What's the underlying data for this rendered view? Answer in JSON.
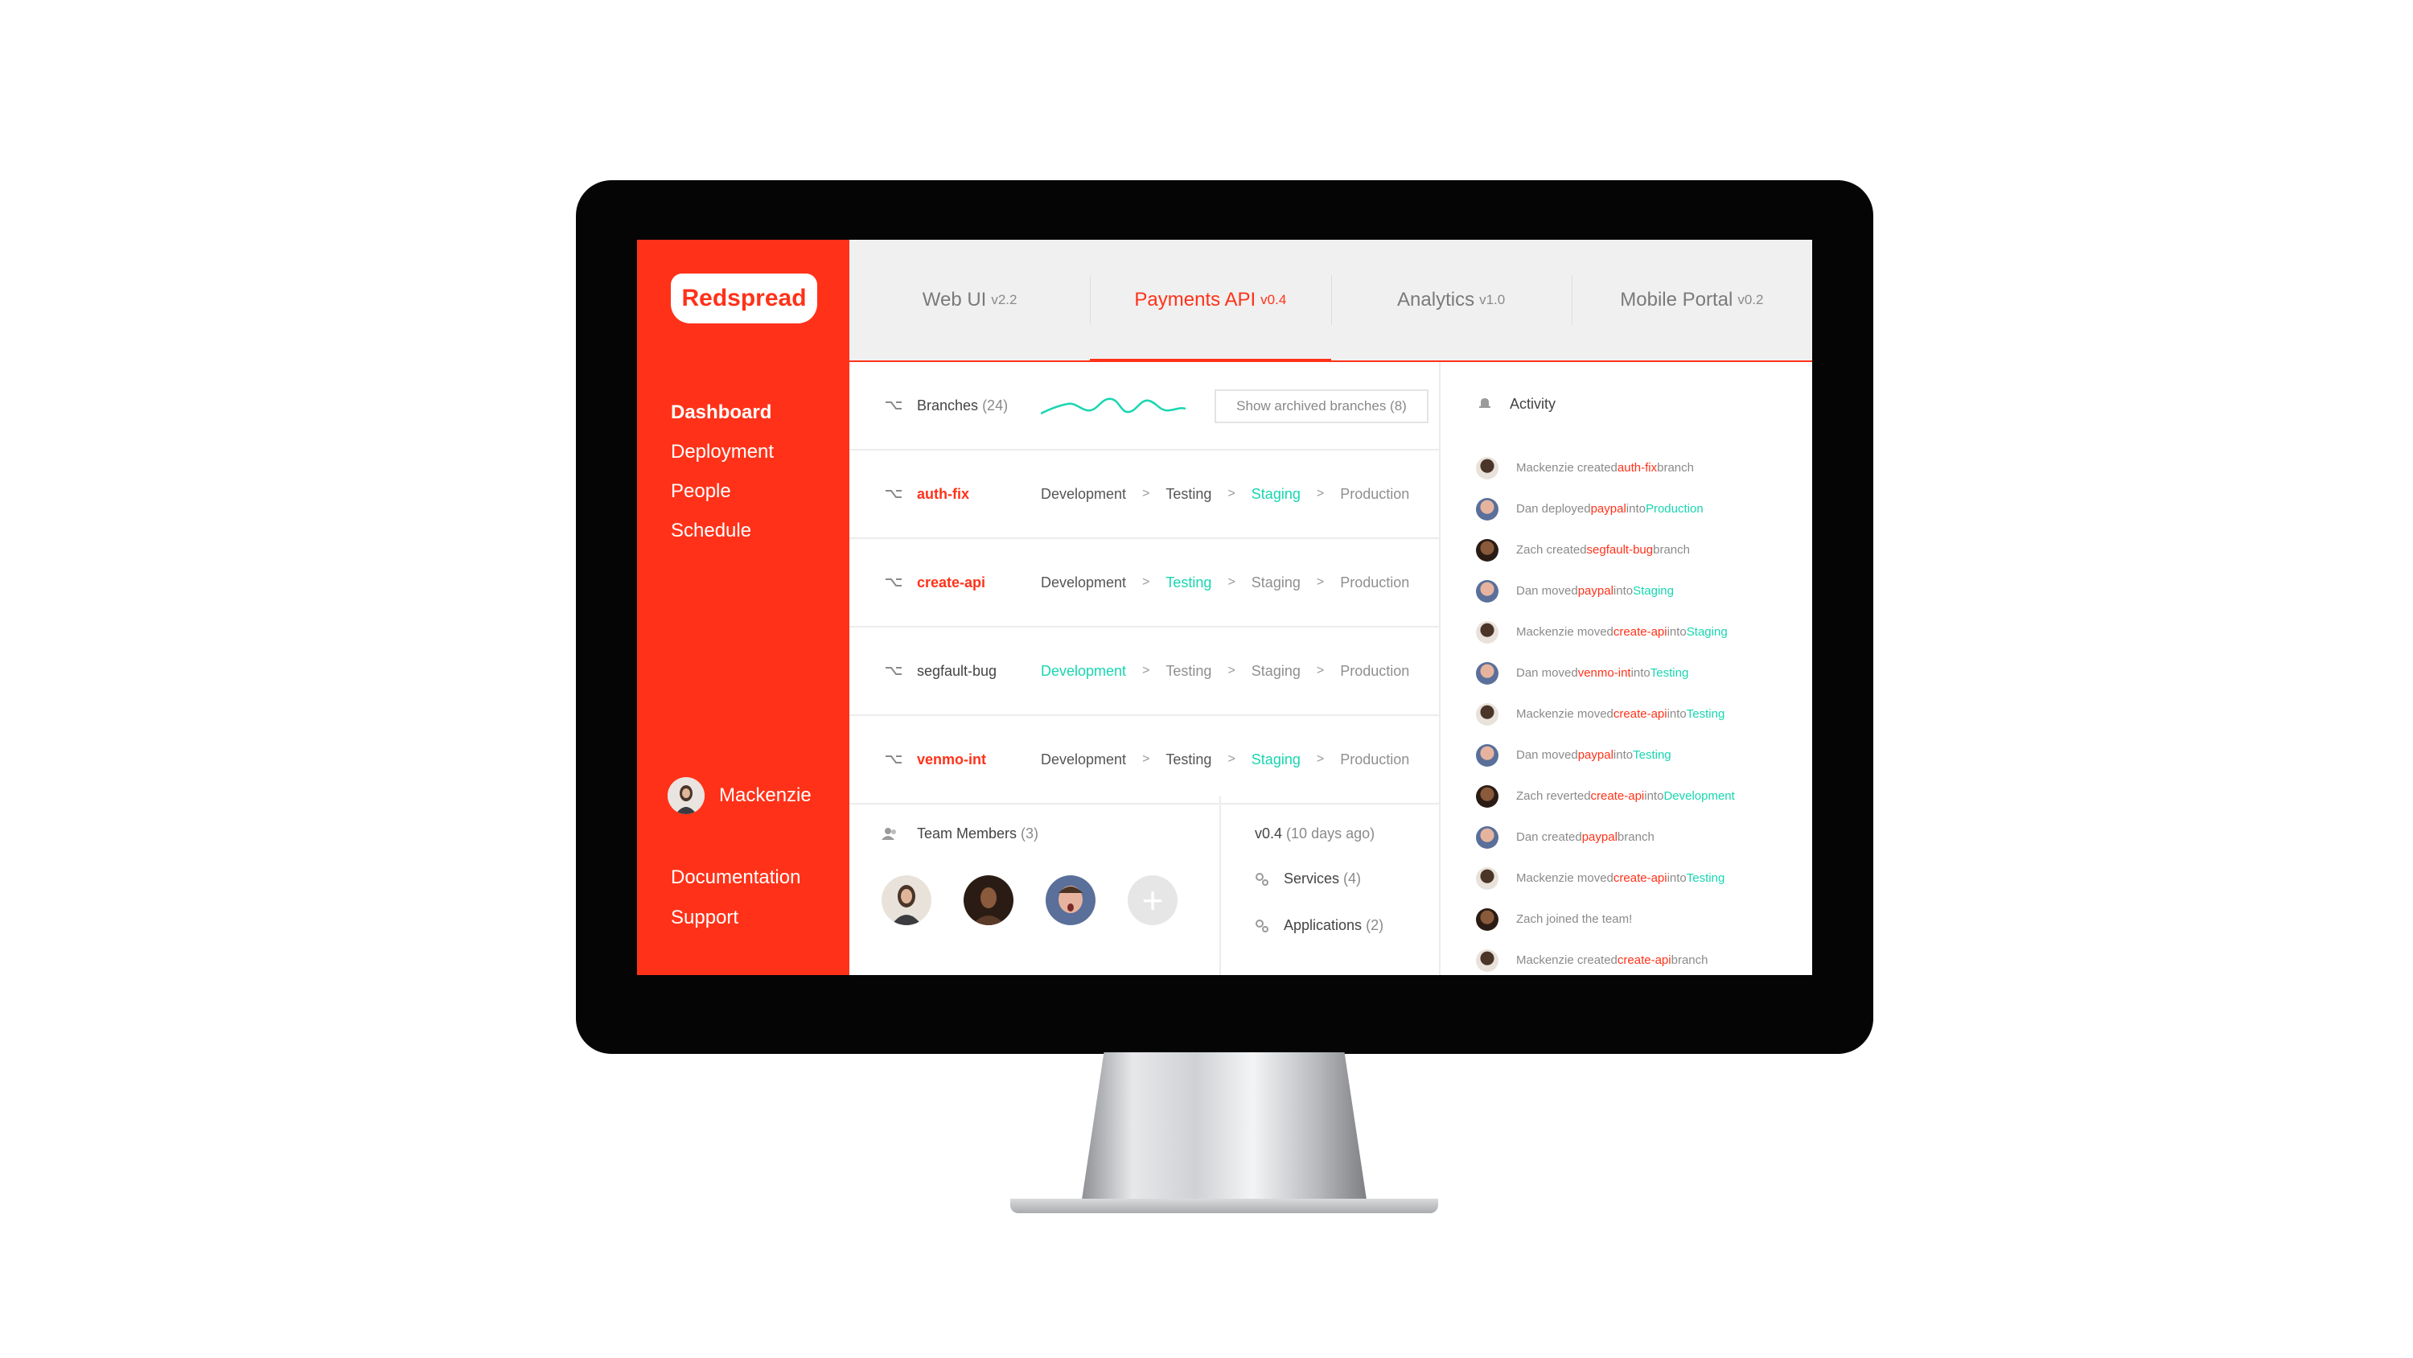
{
  "logo": "Redspread",
  "nav": [
    "Dashboard",
    "Deployment",
    "People",
    "Schedule"
  ],
  "user": "Mackenzie",
  "links": [
    "Documentation",
    "Support"
  ],
  "tabs": [
    {
      "name": "Web UI",
      "version": "v2.2"
    },
    {
      "name": "Payments API",
      "version": "v0.4"
    },
    {
      "name": "Analytics",
      "version": "v1.0"
    },
    {
      "name": "Mobile Portal",
      "version": "v0.2"
    }
  ],
  "branches": {
    "label": "Branches",
    "count": "(24)",
    "archived_button": "Show archived branches (8)",
    "stage_labels": [
      "Development",
      "Testing",
      "Staging",
      "Production"
    ],
    "separator": ">",
    "rows": [
      {
        "name": "auth-fix",
        "current": "Staging"
      },
      {
        "name": "create-api",
        "current": "Testing"
      },
      {
        "name": "segfault-bug",
        "current": "Development"
      },
      {
        "name": "venmo-int",
        "current": "Staging"
      }
    ]
  },
  "team": {
    "label": "Team Members",
    "count": "(3)"
  },
  "release": {
    "version": "v0.4",
    "age": "(10 days ago)",
    "services_label": "Services",
    "services_count": "(4)",
    "applications_label": "Applications",
    "applications_count": "(2)"
  },
  "activity": {
    "title": "Activity",
    "items": [
      {
        "user": "Mackenzie",
        "text1": "Mackenzie created ",
        "branch": "auth-fix",
        "text2": " branch",
        "stage": ""
      },
      {
        "user": "Dan",
        "text1": "Dan deployed ",
        "branch": "paypal",
        "text2": " into ",
        "stage": "Production"
      },
      {
        "user": "Zach",
        "text1": "Zach created ",
        "branch": "segfault-bug",
        "text2": " branch",
        "stage": ""
      },
      {
        "user": "Dan",
        "text1": "Dan moved ",
        "branch": "paypal",
        "text2": " into ",
        "stage": "Staging"
      },
      {
        "user": "Mackenzie",
        "text1": "Mackenzie moved ",
        "branch": "create-api",
        "text2": " into ",
        "stage": "Staging"
      },
      {
        "user": "Dan",
        "text1": "Dan moved ",
        "branch": "venmo-int",
        "text2": " into ",
        "stage": "Testing"
      },
      {
        "user": "Mackenzie",
        "text1": "Mackenzie moved ",
        "branch": "create-api",
        "text2": " into ",
        "stage": "Testing"
      },
      {
        "user": "Dan",
        "text1": "Dan moved ",
        "branch": "paypal",
        "text2": " into ",
        "stage": "Testing"
      },
      {
        "user": "Zach",
        "text1": "Zach reverted ",
        "branch": "create-api",
        "text2": " into ",
        "stage": "Development"
      },
      {
        "user": "Dan",
        "text1": "Dan created ",
        "branch": "paypal",
        "text2": " branch",
        "stage": ""
      },
      {
        "user": "Mackenzie",
        "text1": "Mackenzie moved ",
        "branch": "create-api",
        "text2": " into ",
        "stage": "Testing"
      },
      {
        "user": "Zach",
        "text1": "Zach joined the team!",
        "branch": "",
        "text2": "",
        "stage": ""
      },
      {
        "user": "Mackenzie",
        "text1": "Mackenzie created ",
        "branch": "create-api",
        "text2": " branch",
        "stage": ""
      }
    ]
  },
  "colors": {
    "accent": "#ff3219",
    "current_stage": "#17d6b0"
  },
  "icons": [
    "branch-icon",
    "team-icon",
    "bell-icon",
    "gear-icon",
    "plus-icon",
    "sparkline"
  ]
}
